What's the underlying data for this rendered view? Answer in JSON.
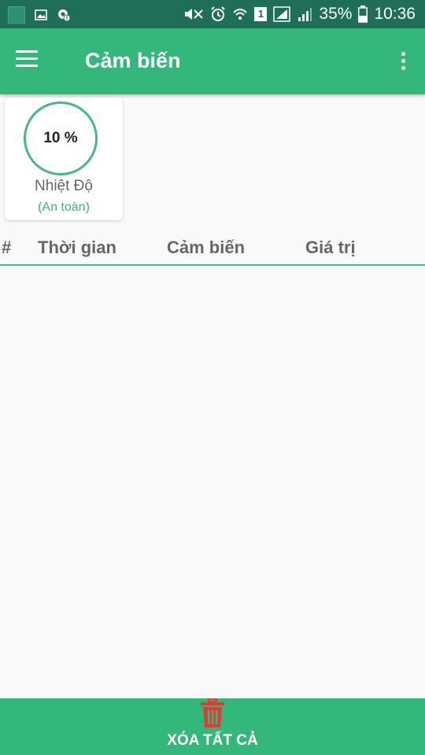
{
  "status_bar": {
    "battery_percent": "35%",
    "time": "10:36",
    "sim_slot": "1"
  },
  "toolbar": {
    "title": "Cảm biến"
  },
  "sensor_card": {
    "gauge_value": "10 %",
    "name": "Nhiệt Độ",
    "status": "(An toàn)",
    "status_color": "#3ab37e"
  },
  "table": {
    "headers": [
      "#",
      "Thời gian",
      "Cảm biến",
      "Giá trị"
    ],
    "rows": []
  },
  "bottom_action": {
    "label": "XÓA TẤT CẢ",
    "icon": "trash-icon",
    "icon_color": "#e53935"
  },
  "colors": {
    "primary": "#34b77a",
    "status_bar": "#1f6f58"
  }
}
